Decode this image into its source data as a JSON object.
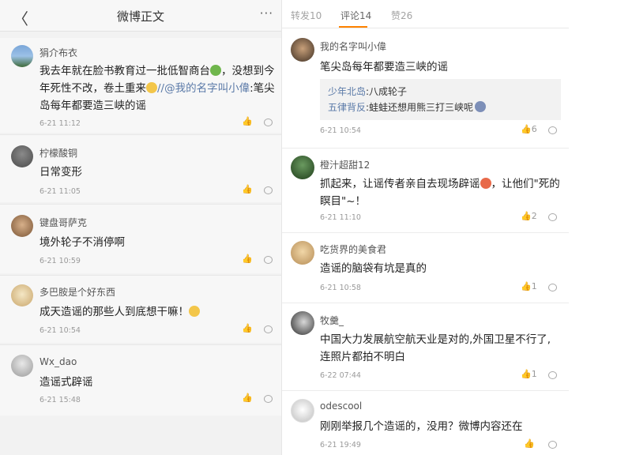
{
  "left": {
    "title": "微博正文",
    "back_glyph": "〈",
    "more_glyph": "···",
    "comments": [
      {
        "user": "狷介布衣",
        "text_before": "我去年就在脸书教育过一批低智商台",
        "text_middle": "，没想到今年死性不改，卷土重来",
        "text_slash": "//",
        "mention": "@我的名字叫小偉",
        "text_after": ":笔尖岛每年都要造三峡的谣",
        "time": "6-21 11:12"
      },
      {
        "user": "柠檬酸铜",
        "text": "日常变形",
        "time": "6-21 11:05"
      },
      {
        "user": "键盘哥萨克",
        "text": "境外轮子不消停啊",
        "time": "6-21 10:59"
      },
      {
        "user": "多巴胺是个好东西",
        "text": "成天造谣的那些人到底想干嘛！",
        "time": "6-21 10:54"
      },
      {
        "user": "Wx_dao",
        "text": "造谣式辟谣",
        "time": "6-21 15:48"
      }
    ]
  },
  "right": {
    "tabs": [
      {
        "label": "转发10"
      },
      {
        "label": "评论14"
      },
      {
        "label": "赞26"
      }
    ],
    "comments": [
      {
        "user": "我的名字叫小偉",
        "text": "笔尖岛每年都要造三峡的谣",
        "replies": [
          {
            "user": "少年北岛",
            "text": ":八成轮子"
          },
          {
            "user": "五律背反",
            "text": ":蛙蛙还想用熊三打三峡呢"
          }
        ],
        "time": "6-21 10:54",
        "likes": "6"
      },
      {
        "user": "橙汁超甜12",
        "text": "抓起来，让谣传者亲自去现场辟谣",
        "text2": "，让他们\"死的瞑目\"~！",
        "time": "6-21 11:10",
        "likes": "2"
      },
      {
        "user": "吃货界的美食君",
        "text": "造谣的脑袋有坑是真的",
        "time": "6-21 10:58",
        "likes": "1"
      },
      {
        "user": "牧羹_",
        "text": "中国大力发展航空航天业是对的,外国卫星不行了,连照片都拍不明白",
        "time": "6-22 07:44",
        "likes": "1"
      },
      {
        "user": "odescool",
        "text": "刚刚举报几个造谣的，没用？微博内容还在",
        "time": "6-21 19:49",
        "likes": ""
      }
    ]
  },
  "icons": {
    "like": "thumbs-up-icon",
    "reply": "comment-bubble-icon",
    "like_glyph": "👍"
  }
}
